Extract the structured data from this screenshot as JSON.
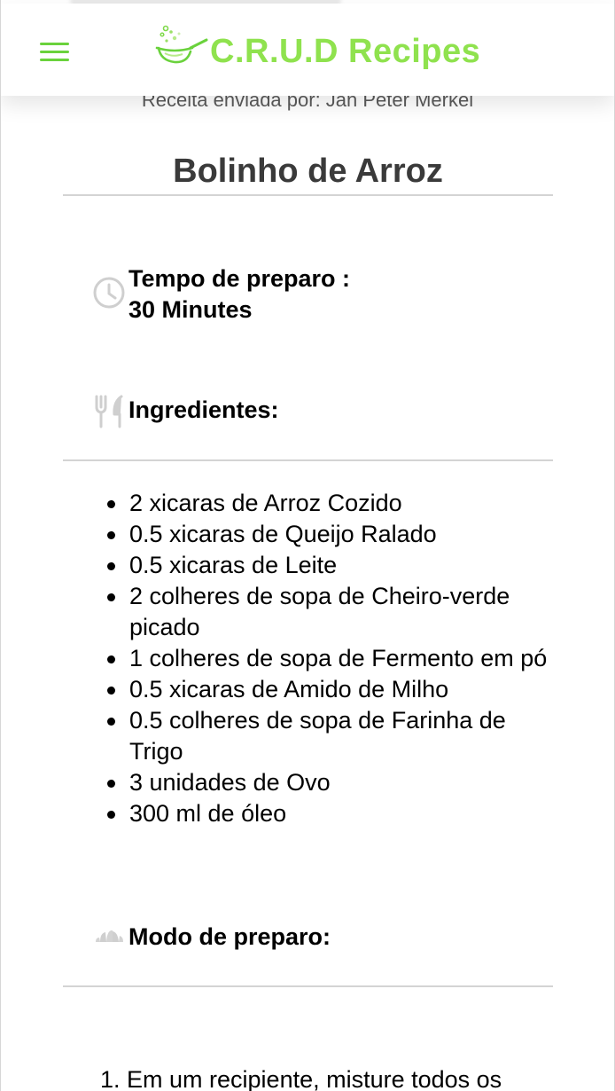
{
  "app": {
    "brand": "C.R.U.D Recipes",
    "accent_color": "#8fe24e",
    "menu_icon": "hamburger-menu-icon",
    "logo_icon": "cooking-pan-icon"
  },
  "recipe": {
    "submitted_by": "Receita enviada por: Jan Peter Merkel",
    "title": "Bolinho de Arroz",
    "prep_time": {
      "icon": "clock-icon",
      "label": "Tempo de preparo :",
      "value": "30 Minutes"
    },
    "ingredients": {
      "icon": "fork-knife-icon",
      "heading": "Ingredientes:",
      "items": [
        "2 xicaras de Arroz Cozido",
        "0.5 xicaras de Queijo Ralado",
        "0.5 xicaras de Leite",
        "2 colheres de sopa de Cheiro-verde picado",
        "1 colheres de sopa de Fermento em pó",
        "0.5 xicaras de Amido de Milho",
        "0.5 colheres de sopa de Farinha de Trigo",
        "3 unidades de Ovo",
        "300 ml de óleo"
      ]
    },
    "preparation": {
      "icon": "croissant-icon",
      "heading": "Modo de preparo:",
      "steps": [
        "1. Em um recipiente, misture todos os"
      ]
    }
  }
}
